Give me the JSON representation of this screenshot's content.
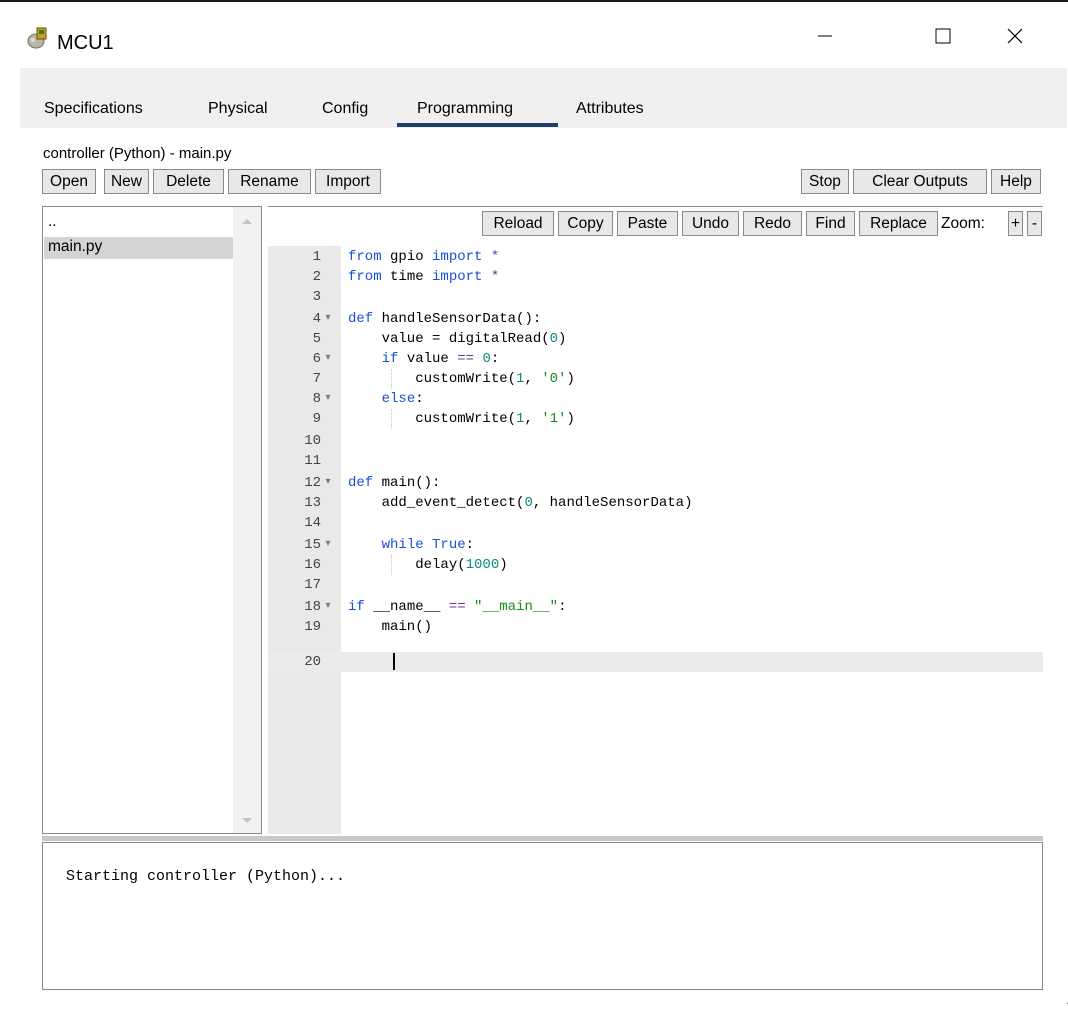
{
  "window": {
    "title": "MCU1",
    "icon": "mcu-device-icon",
    "controls": [
      "minimize-icon",
      "maximize-icon",
      "close-icon"
    ]
  },
  "tabs": {
    "items": [
      "Specifications",
      "Physical",
      "Config",
      "Programming",
      "Attributes"
    ],
    "active": "Programming"
  },
  "toolbar": {
    "controller_label": "controller (Python) - main.py",
    "open": "Open",
    "new": "New",
    "delete": "Delete",
    "rename": "Rename",
    "import": "Import",
    "stop": "Stop",
    "clear_outputs": "Clear Outputs",
    "help": "Help"
  },
  "editor_toolbar": {
    "reload": "Reload",
    "copy": "Copy",
    "paste": "Paste",
    "undo": "Undo",
    "redo": "Redo",
    "find": "Find",
    "replace": "Replace",
    "zoom_label": "Zoom:",
    "zoom_in": "+",
    "zoom_out": "-"
  },
  "file_list": {
    "parent": "..",
    "files": [
      "main.py"
    ],
    "selected": "main.py"
  },
  "code": {
    "lines": [
      "from gpio import *",
      "from time import *",
      "",
      "def handleSensorData():",
      "    value = digitalRead(0)",
      "    if value == 0:",
      "        customWrite(1, '0')",
      "    else:",
      "        customWrite(1, '1')",
      "",
      "",
      "def main():",
      "    add_event_detect(0, handleSensorData)",
      "",
      "    while True:",
      "        delay(1000)",
      "",
      "if __name__ == \"__main__\":",
      "    main()",
      ""
    ],
    "foldable_lines": [
      4,
      6,
      8,
      12,
      15,
      18
    ],
    "active_line": 20
  },
  "output": {
    "text": "Starting controller (Python)..."
  },
  "colors": {
    "keyword": "#1b4fd8",
    "number": "#0a8a7a",
    "string": "#1a8a1a",
    "tab_underline": "#1f3f6f",
    "window_bg": "#f0f0f0"
  }
}
